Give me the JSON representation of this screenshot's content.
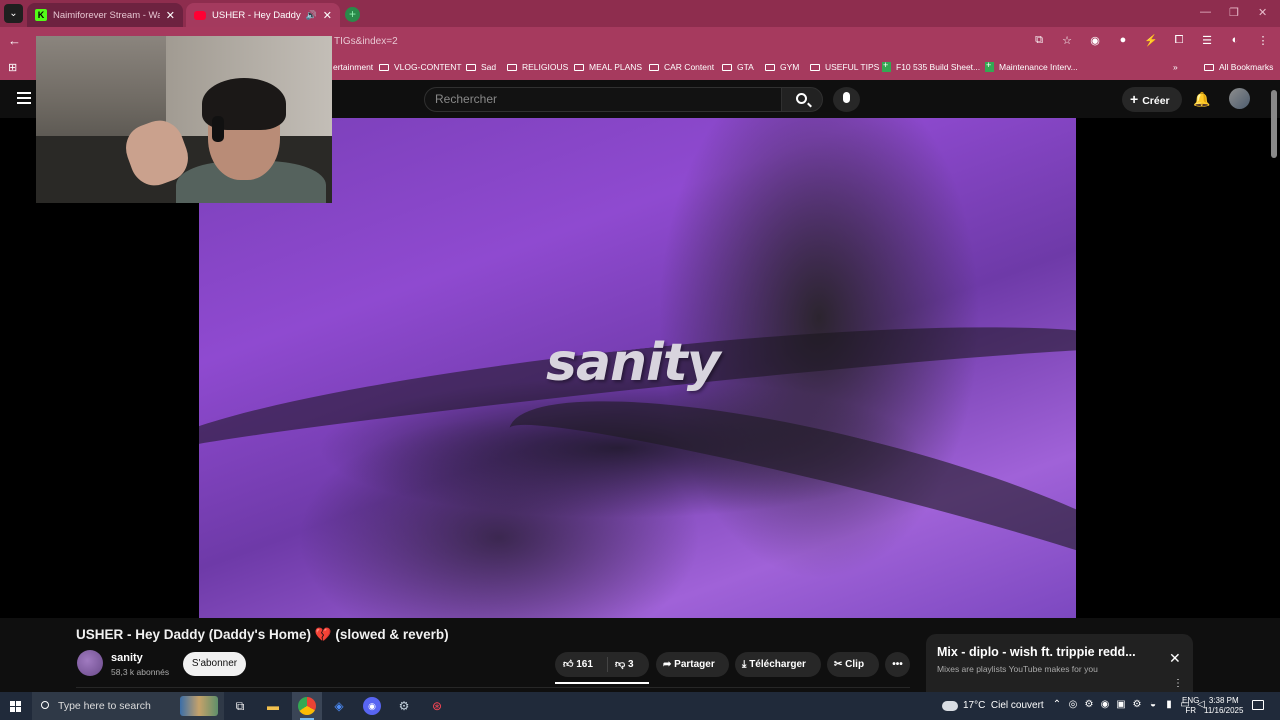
{
  "browser": {
    "tabs": [
      {
        "title": "Naimiforever Stream - Watch L",
        "favicon": "kick-icon",
        "active": false
      },
      {
        "title": "USHER - Hey Daddy (Daddy",
        "favicon": "youtube-icon",
        "active": true
      }
    ],
    "url_fragment": "TIGs&index=2",
    "bookmarks": [
      {
        "label": "ertainment",
        "icon": "folder-icon"
      },
      {
        "label": "VLOG-CONTENT",
        "icon": "folder-icon"
      },
      {
        "label": "Sad",
        "icon": "folder-icon"
      },
      {
        "label": "RELIGIOUS",
        "icon": "folder-icon"
      },
      {
        "label": "MEAL PLANS",
        "icon": "folder-icon"
      },
      {
        "label": "CAR Content",
        "icon": "folder-icon"
      },
      {
        "label": "GTA",
        "icon": "folder-icon"
      },
      {
        "label": "GYM",
        "icon": "folder-icon"
      },
      {
        "label": "USEFUL TIPS",
        "icon": "folder-icon"
      },
      {
        "label": "F10 535 Build Sheet...",
        "icon": "sheets-icon"
      },
      {
        "label": "Maintenance Interv...",
        "icon": "sheets-icon"
      }
    ],
    "all_bookmarks": "All Bookmarks",
    "overflow": "»"
  },
  "youtube": {
    "search_placeholder": "Rechercher",
    "create_label": "Créer",
    "video_overlay_text": "sanity",
    "video_title": "USHER - Hey Daddy (Daddy's Home)",
    "video_title_emoji": "💔",
    "video_title_suffix": "(slowed & reverb)",
    "channel_name": "sanity",
    "subscribers": "58,3 k abonnés",
    "subscribe_label": "S'abonner",
    "likes": "161",
    "dislikes": "3",
    "share_label": "Partager",
    "download_label": "Télécharger",
    "clip_label": "Clip"
  },
  "mix_panel": {
    "title": "Mix - diplo - wish ft. trippie redd...",
    "subtitle": "Mixes are playlists YouTube makes for you"
  },
  "taskbar": {
    "search_placeholder": "Type here to search",
    "weather_temp": "17°C",
    "weather_desc": "Ciel couvert",
    "lang_top": "ENG",
    "lang_bottom": "FR",
    "time": "3:38 PM",
    "date": "11/16/2025"
  },
  "colors": {
    "browser_accent": "#a63a5e",
    "youtube_bg": "#0f0f0f",
    "video_purple": "#8f4ad0"
  }
}
